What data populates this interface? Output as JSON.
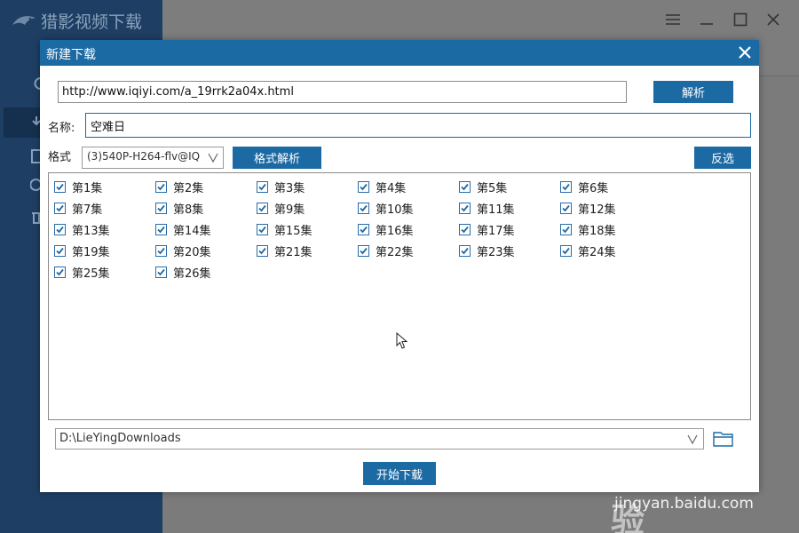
{
  "app": {
    "title": "猎影视频下载",
    "window_controls": [
      "menu-icon",
      "minimize-icon",
      "maximize-icon",
      "close-icon"
    ]
  },
  "dialog": {
    "title": "新建下载",
    "url_value": "http://www.iqiyi.com/a_19rrk2a04x.html",
    "parse_label": "解析",
    "name_label": "名称:",
    "name_value": "空难日",
    "format_label": "格式",
    "format_value": "(3)540P-H264-flv@IQ",
    "format_parse_label": "格式解析",
    "invert_label": "反选",
    "episodes": [
      {
        "label": "第1集",
        "checked": true
      },
      {
        "label": "第2集",
        "checked": true
      },
      {
        "label": "第3集",
        "checked": true
      },
      {
        "label": "第4集",
        "checked": true
      },
      {
        "label": "第5集",
        "checked": true
      },
      {
        "label": "第6集",
        "checked": true
      },
      {
        "label": "第7集",
        "checked": true
      },
      {
        "label": "第8集",
        "checked": true
      },
      {
        "label": "第9集",
        "checked": true
      },
      {
        "label": "第10集",
        "checked": true
      },
      {
        "label": "第11集",
        "checked": true
      },
      {
        "label": "第12集",
        "checked": true
      },
      {
        "label": "第13集",
        "checked": true
      },
      {
        "label": "第14集",
        "checked": true
      },
      {
        "label": "第15集",
        "checked": true
      },
      {
        "label": "第16集",
        "checked": true
      },
      {
        "label": "第17集",
        "checked": true
      },
      {
        "label": "第18集",
        "checked": true
      },
      {
        "label": "第19集",
        "checked": true
      },
      {
        "label": "第20集",
        "checked": true
      },
      {
        "label": "第21集",
        "checked": true
      },
      {
        "label": "第22集",
        "checked": true
      },
      {
        "label": "第23集",
        "checked": true
      },
      {
        "label": "第24集",
        "checked": true
      },
      {
        "label": "第25集",
        "checked": true
      },
      {
        "label": "第26集",
        "checked": true
      }
    ],
    "save_path": "D:\\LieYingDownloads",
    "start_label": "开始下载"
  },
  "watermark": {
    "logo": "Baidu经验",
    "url": "jingyan.baidu.com"
  },
  "colors": {
    "accent": "#1c6aa3",
    "sidebar": "#1e3f63"
  }
}
